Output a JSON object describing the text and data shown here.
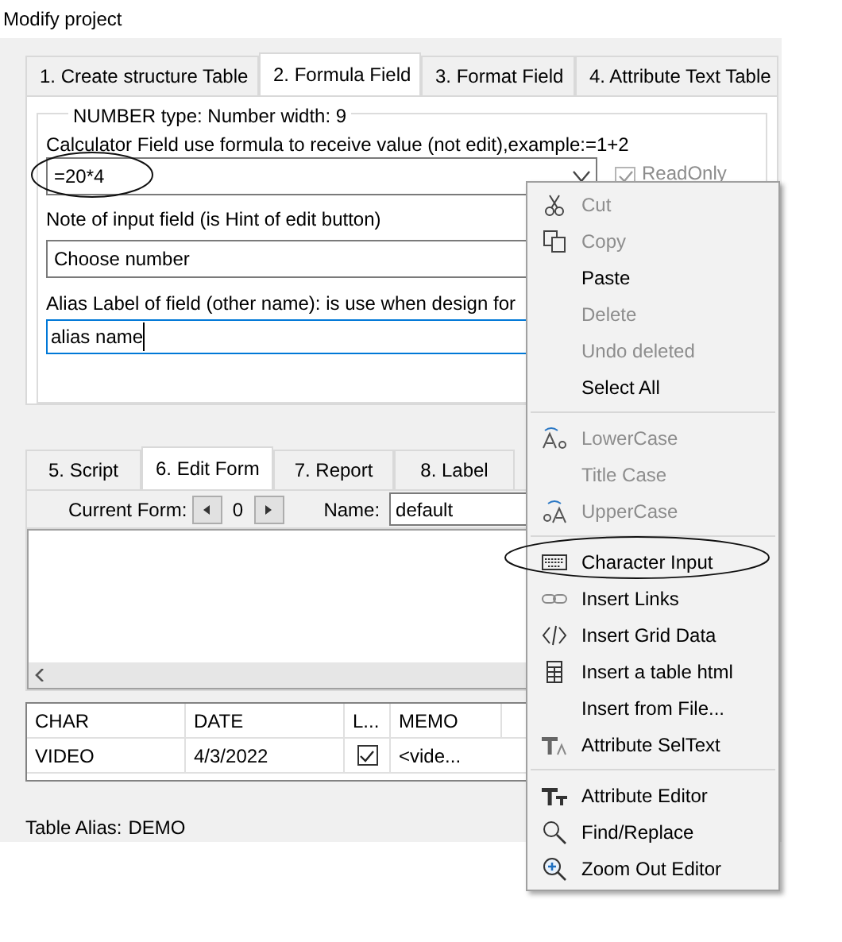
{
  "window": {
    "title": "Modify project"
  },
  "tabs": [
    {
      "label": "1. Create structure Table",
      "selected": false
    },
    {
      "label": "2. Formula Field",
      "selected": true
    },
    {
      "label": "3. Format Field",
      "selected": false
    },
    {
      "label": "4. Attribute Text Table",
      "selected": false
    }
  ],
  "formula_group": {
    "title": "NUMBER type: Number width: 9",
    "formula_label": "Calculator Field use formula to receive value (not edit),example:=1+2",
    "formula_value": "=20*4",
    "read_only": {
      "label": "ReadOnly",
      "checked": true,
      "disabled": true
    },
    "note_label": "Note of input field (is Hint of edit button)",
    "note_value": "Choose number",
    "alias_label": "Alias Label of field (other name): is use when design for",
    "alias_value": "alias name"
  },
  "lower_tabs": [
    {
      "label": "5. Script",
      "selected": false
    },
    {
      "label": "6. Edit Form",
      "selected": true
    },
    {
      "label": "7. Report",
      "selected": false
    },
    {
      "label": "8. Label",
      "selected": false
    }
  ],
  "current_form": {
    "label": "Current Form:",
    "value": "0"
  },
  "form_name": {
    "label": "Name:",
    "value": "default"
  },
  "grid": {
    "columns": [
      "CHAR",
      "DATE",
      "L...",
      "MEMO"
    ],
    "rows": [
      {
        "char": "VIDEO",
        "date": "4/3/2022",
        "checked": true,
        "memo": "<vide..."
      }
    ]
  },
  "table_alias": {
    "label": "Table Alias:",
    "value": "DEMO"
  },
  "context_menu": {
    "items": [
      {
        "kind": "item",
        "label": "Cut",
        "disabled": true
      },
      {
        "kind": "item",
        "label": "Copy",
        "disabled": true
      },
      {
        "kind": "item",
        "label": "Paste",
        "disabled": false
      },
      {
        "kind": "item",
        "label": "Delete",
        "disabled": true
      },
      {
        "kind": "item",
        "label": "Undo deleted",
        "disabled": true
      },
      {
        "kind": "item",
        "label": "Select All",
        "disabled": false
      },
      {
        "kind": "separator"
      },
      {
        "kind": "item",
        "label": "LowerCase",
        "disabled": true
      },
      {
        "kind": "item",
        "label": "Title Case",
        "disabled": true
      },
      {
        "kind": "item",
        "label": "UpperCase",
        "disabled": true
      },
      {
        "kind": "separator"
      },
      {
        "kind": "item",
        "label": "Character Input",
        "disabled": false
      },
      {
        "kind": "item",
        "label": "Insert Links",
        "disabled": false
      },
      {
        "kind": "item",
        "label": "Insert Grid Data",
        "disabled": false
      },
      {
        "kind": "item",
        "label": "Insert a table html",
        "disabled": false
      },
      {
        "kind": "item",
        "label": "Insert from File...",
        "disabled": false
      },
      {
        "kind": "item",
        "label": "Attribute SelText",
        "disabled": false
      },
      {
        "kind": "separator"
      },
      {
        "kind": "item",
        "label": "Attribute Editor",
        "disabled": false
      },
      {
        "kind": "item",
        "label": "Find/Replace",
        "disabled": false
      },
      {
        "kind": "item",
        "label": "Zoom Out Editor",
        "disabled": false
      }
    ]
  }
}
